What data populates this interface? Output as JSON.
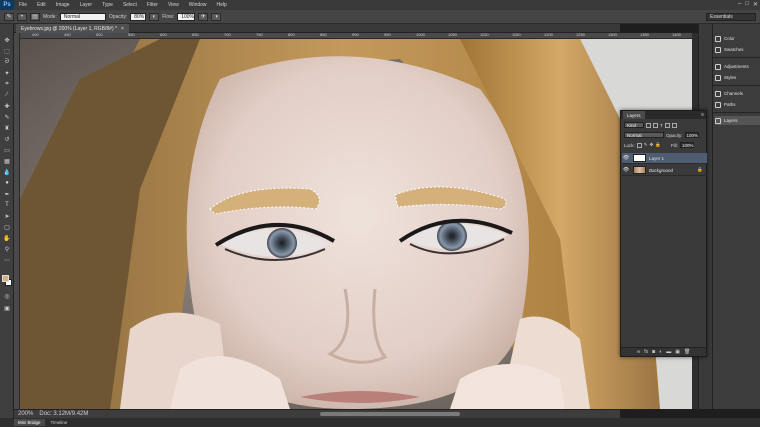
{
  "app": {
    "logo": "Ps"
  },
  "menu": [
    "File",
    "Edit",
    "Image",
    "Layer",
    "Type",
    "Select",
    "Filter",
    "View",
    "Window",
    "Help"
  ],
  "window_controls": [
    "–",
    "□",
    "✕"
  ],
  "options_bar": {
    "mode_label": "Mode:",
    "mode_value": "Normal",
    "opacity_label": "Opacity:",
    "opacity_value": "80%",
    "flow_label": "Flow:",
    "flow_value": "100%",
    "workspace": "Essentials"
  },
  "document": {
    "tab_title": "Eyebrows.jpg @ 200% (Layer 1, RGB/8#) *",
    "tab_close": "×",
    "zoom": "200%",
    "doc_info": "Doc: 3.12M/9.42M"
  },
  "ruler_ticks": [
    "400",
    "450",
    "500",
    "550",
    "600",
    "650",
    "700",
    "750",
    "800",
    "850",
    "900",
    "950",
    "1000",
    "1050",
    "1100",
    "1150",
    "1200",
    "1250",
    "1300",
    "1350",
    "1400"
  ],
  "right_dock": {
    "items": [
      {
        "label": "Color",
        "icon": "color-icon"
      },
      {
        "label": "Swatches",
        "icon": "swatches-icon"
      },
      {
        "label": "Adjustments",
        "icon": "adjustments-icon"
      },
      {
        "label": "Styles",
        "icon": "styles-icon"
      },
      {
        "label": "Channels",
        "icon": "channels-icon"
      },
      {
        "label": "Paths",
        "icon": "paths-icon"
      },
      {
        "label": "Layers",
        "icon": "layers-icon"
      }
    ]
  },
  "layers_panel": {
    "tab": "Layers",
    "kind_filter": "Kind",
    "blend_mode": "Normal",
    "opacity_label": "Opacity:",
    "opacity_value": "100%",
    "lock_label": "Lock:",
    "fill_label": "Fill:",
    "fill_value": "100%",
    "layers": [
      {
        "name": "Layer 1",
        "selected": true
      },
      {
        "name": "Background",
        "selected": false
      }
    ]
  },
  "bottom_tabs": [
    "Mini Bridge",
    "Timeline"
  ],
  "colors": {
    "foreground": "#d9b07a",
    "background": "#ffffff",
    "eyebrow_fill": "#d4b07a",
    "selection": "#4f5d73"
  }
}
